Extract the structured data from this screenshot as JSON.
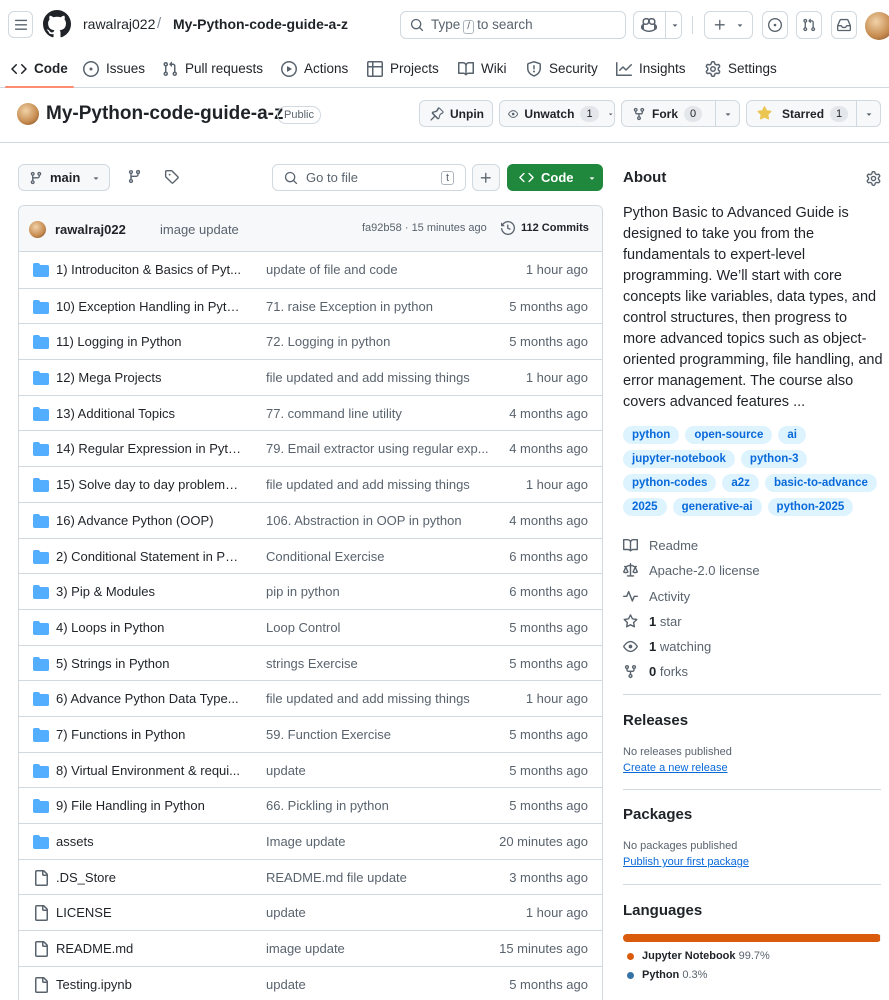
{
  "header": {
    "owner": "rawalraj022",
    "separator": "/",
    "repo": "My-Python-code-guide-a-z",
    "search_prefix": "Type",
    "search_key": "/",
    "search_suffix": "to search"
  },
  "tabs": [
    {
      "label": "Code",
      "icon": "code-icon",
      "selected": true
    },
    {
      "label": "Issues",
      "icon": "issue-icon"
    },
    {
      "label": "Pull requests",
      "icon": "pull-request-icon"
    },
    {
      "label": "Actions",
      "icon": "play-icon"
    },
    {
      "label": "Projects",
      "icon": "table-icon"
    },
    {
      "label": "Wiki",
      "icon": "book-icon"
    },
    {
      "label": "Security",
      "icon": "shield-icon"
    },
    {
      "label": "Insights",
      "icon": "graph-icon"
    },
    {
      "label": "Settings",
      "icon": "gear-icon"
    }
  ],
  "repo": {
    "title": "My-Python-code-guide-a-z",
    "visibility": "Public",
    "unpin": "Unpin",
    "unwatch": "Unwatch",
    "watch_count": "1",
    "fork": "Fork",
    "fork_count": "0",
    "starred": "Starred",
    "star_count": "1"
  },
  "toolbar": {
    "branch": "main",
    "goto_file": "Go to file",
    "goto_key": "t",
    "code": "Code"
  },
  "commit": {
    "author": "rawalraj022",
    "message": "image update",
    "hash": "fa92b58",
    "dot": "·",
    "time": "15 minutes ago",
    "commits": "112 Commits"
  },
  "files": [
    {
      "type": "dir",
      "name": "1) Introduciton & Basics of Pyt...",
      "message": "update of file and code",
      "age": "1 hour ago"
    },
    {
      "type": "dir",
      "name": "10) Exception Handling in Pyth...",
      "message": "71. raise Exception in python",
      "age": "5 months ago"
    },
    {
      "type": "dir",
      "name": "11) Logging in Python",
      "message": "72. Logging in python",
      "age": "5 months ago"
    },
    {
      "type": "dir",
      "name": "12) Mega Projects",
      "message": "file updated and add missing things",
      "age": "1 hour ago"
    },
    {
      "type": "dir",
      "name": "13) Additional Topics",
      "message": "77. command line utility",
      "age": "4 months ago"
    },
    {
      "type": "dir",
      "name": "14) Regular Expression in Pyth...",
      "message": "79. Email extractor using regular exp...",
      "age": "4 months ago"
    },
    {
      "type": "dir",
      "name": "15) Solve day to day problems ...",
      "message": "file updated and add missing things",
      "age": "1 hour ago"
    },
    {
      "type": "dir",
      "name": "16) Advance Python (OOP)",
      "message": "106. Abstraction in OOP in python",
      "age": "4 months ago"
    },
    {
      "type": "dir",
      "name": "2) Conditional Statement in Py...",
      "message": "Conditional Exercise",
      "age": "6 months ago"
    },
    {
      "type": "dir",
      "name": "3) Pip & Modules",
      "message": "pip in python",
      "age": "6 months ago"
    },
    {
      "type": "dir",
      "name": "4) Loops in Python",
      "message": "Loop Control",
      "age": "5 months ago"
    },
    {
      "type": "dir",
      "name": "5) Strings in Python",
      "message": "strings Exercise",
      "age": "5 months ago"
    },
    {
      "type": "dir",
      "name": "6) Advance Python Data Type...",
      "message": "file updated and add missing things",
      "age": "1 hour ago"
    },
    {
      "type": "dir",
      "name": "7) Functions in Python",
      "message": "59. Function Exercise",
      "age": "5 months ago"
    },
    {
      "type": "dir",
      "name": "8) Virtual Environment & requi...",
      "message": "update",
      "age": "5 months ago"
    },
    {
      "type": "dir",
      "name": "9) File Handling in Python",
      "message": "66. Pickling in python",
      "age": "5 months ago"
    },
    {
      "type": "dir",
      "name": "assets",
      "message": "Image update",
      "age": "20 minutes ago"
    },
    {
      "type": "file",
      "name": ".DS_Store",
      "message": "README.md file update",
      "age": "3 months ago"
    },
    {
      "type": "file",
      "name": "LICENSE",
      "message": "update",
      "age": "1 hour ago"
    },
    {
      "type": "file",
      "name": "README.md",
      "message": "image update",
      "age": "15 minutes ago"
    },
    {
      "type": "file",
      "name": "Testing.ipynb",
      "message": "update",
      "age": "5 months ago"
    }
  ],
  "about": {
    "title": "About",
    "description": "Python Basic to Advanced Guide is designed to take you from the fundamentals to expert-level programming. We’ll start with core concepts like variables, data types, and control structures, then progress to more advanced topics such as object-oriented programming, file handling, and error management. The course also covers advanced features ...",
    "topics": [
      "python",
      "open-source",
      "ai",
      "jupyter-notebook",
      "python-3",
      "python-codes",
      "a2z",
      "basic-to-advance",
      "2025",
      "generative-ai",
      "python-2025"
    ],
    "readme": "Readme",
    "license": "Apache-2.0 license",
    "activity": "Activity",
    "stars_num": "1",
    "stars_label": "star",
    "watching_num": "1",
    "watching_label": "watching",
    "forks_num": "0",
    "forks_label": "forks"
  },
  "releases": {
    "title": "Releases",
    "empty": "No releases published",
    "link": "Create a new release"
  },
  "packages": {
    "title": "Packages",
    "empty": "No packages published",
    "link": "Publish your first package"
  },
  "languages": {
    "title": "Languages",
    "items": [
      {
        "name": "Jupyter Notebook",
        "percent": "99.7%",
        "value": 99.7,
        "color": "#DA5B0B"
      },
      {
        "name": "Python",
        "percent": "0.3%",
        "value": 0.3,
        "color": "#3572A5"
      }
    ]
  }
}
